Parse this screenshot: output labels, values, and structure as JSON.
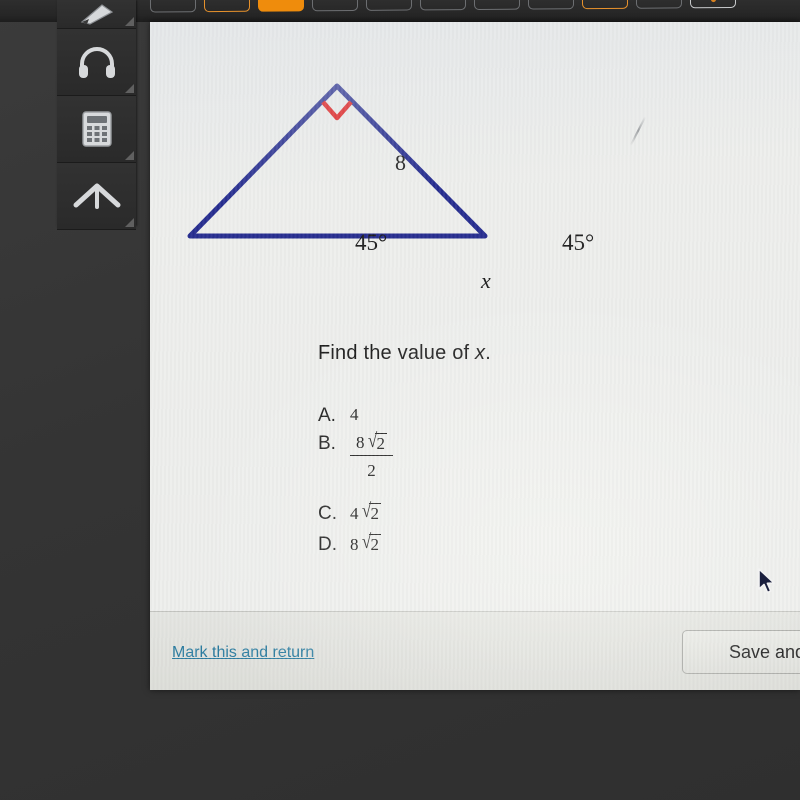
{
  "topbar": {
    "tabs": [
      {
        "style": "plain"
      },
      {
        "style": "orange-outline"
      },
      {
        "style": "orange-filled"
      },
      {
        "style": "plain"
      },
      {
        "style": "plain"
      },
      {
        "style": "plain"
      },
      {
        "style": "plain"
      },
      {
        "style": "plain"
      },
      {
        "style": "orange-outline"
      },
      {
        "style": "plain"
      },
      {
        "style": "light-outline"
      }
    ]
  },
  "rail": {
    "items": [
      {
        "icon": "pen-icon",
        "label": "Pen"
      },
      {
        "icon": "headphones-icon",
        "label": "Headphones"
      },
      {
        "icon": "calculator-icon",
        "label": "Calculator"
      },
      {
        "icon": "chevron-up-icon",
        "label": "Scroll up"
      }
    ]
  },
  "figure": {
    "side_label": "8",
    "left_angle": "45°",
    "right_angle": "45°",
    "base_label": "x",
    "stroke_color": "#262d8f",
    "right_angle_color": "#e01b1b"
  },
  "question": {
    "prompt_before": "Find the value of ",
    "prompt_var": "x",
    "prompt_after": "."
  },
  "choices": [
    {
      "letter": "A.",
      "kind": "plain",
      "value": "4"
    },
    {
      "letter": "B.",
      "kind": "fraction",
      "num_coef": "8",
      "num_radicand": "2",
      "den": "2"
    },
    {
      "letter": "C.",
      "kind": "radical",
      "coef": "4",
      "radicand": "2"
    },
    {
      "letter": "D.",
      "kind": "radical",
      "coef": "8",
      "radicand": "2"
    }
  ],
  "footer": {
    "mark_link": "Mark this and return",
    "save_button": "Save and"
  }
}
